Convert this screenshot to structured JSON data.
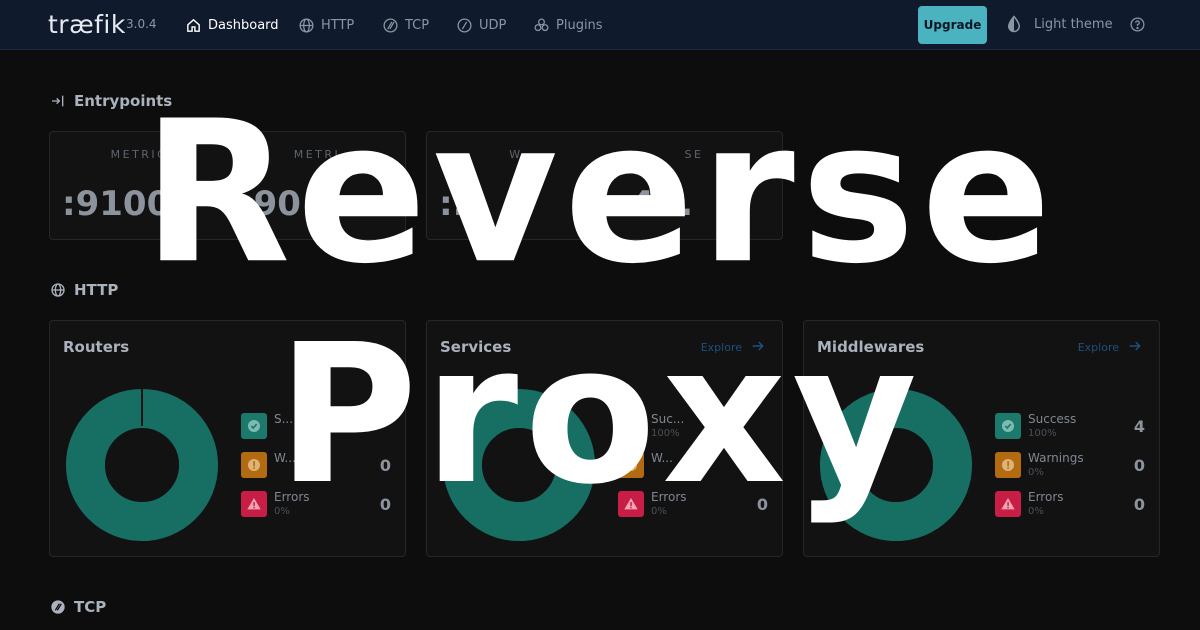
{
  "app": {
    "logo": "træfik",
    "version": "3.0.4"
  },
  "nav": {
    "items": [
      {
        "label": "Dashboard",
        "icon": "home-icon",
        "active": true
      },
      {
        "label": "HTTP",
        "icon": "globe-icon",
        "active": false
      },
      {
        "label": "TCP",
        "icon": "tcp-icon",
        "active": false
      },
      {
        "label": "UDP",
        "icon": "udp-icon",
        "active": false
      },
      {
        "label": "Plugins",
        "icon": "plugins-icon",
        "active": false
      }
    ],
    "upgrade_label": "Upgrade",
    "theme_label": "Light theme",
    "help_icon": "help-icon"
  },
  "entrypoints": {
    "heading": "Entrypoints",
    "cards": [
      {
        "cells": [
          {
            "label": "METRIC",
            "value": ":9100"
          },
          {
            "label": "METRI",
            "value": ":90"
          }
        ]
      },
      {
        "cells": [
          {
            "label": "W",
            "value": ":..."
          },
          {
            "label": "SE",
            "value": ":4..."
          }
        ]
      }
    ]
  },
  "http": {
    "heading": "HTTP",
    "cards": [
      {
        "title": "Routers",
        "explore": "",
        "stats": [
          {
            "label": "S...",
            "pct": "",
            "count": ""
          },
          {
            "label": "W...",
            "pct": "",
            "count": "0"
          },
          {
            "label": "Errors",
            "pct": "0%",
            "count": "0"
          }
        ]
      },
      {
        "title": "Services",
        "explore": "Explore",
        "stats": [
          {
            "label": "Suc...",
            "pct": "100%",
            "count": ""
          },
          {
            "label": "W...",
            "pct": "",
            "count": "0"
          },
          {
            "label": "Errors",
            "pct": "0%",
            "count": "0"
          }
        ]
      },
      {
        "title": "Middlewares",
        "explore": "Explore",
        "stats": [
          {
            "label": "Success",
            "pct": "100%",
            "count": "4"
          },
          {
            "label": "Warnings",
            "pct": "0%",
            "count": "0"
          },
          {
            "label": "Errors",
            "pct": "0%",
            "count": "0"
          }
        ]
      }
    ]
  },
  "tcp": {
    "heading": "TCP"
  },
  "overlay": {
    "line1": "Reverse",
    "line2": "Proxy"
  },
  "colors": {
    "success": "#1b7a6c",
    "warning": "#b36b12",
    "error": "#c81e45",
    "donut": "#176f63",
    "accent": "#4bb2bf"
  }
}
